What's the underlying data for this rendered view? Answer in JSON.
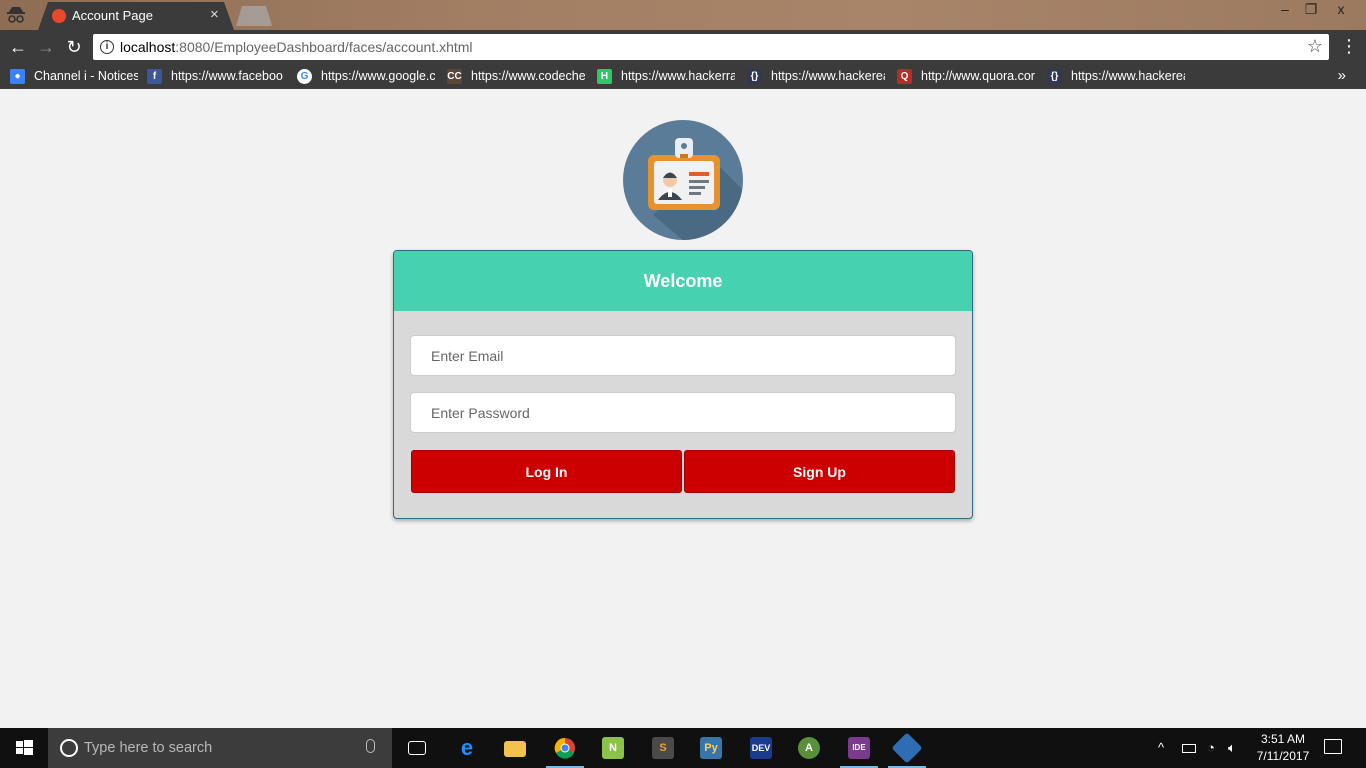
{
  "browser": {
    "tab": {
      "title": "Account Page",
      "close": "×"
    },
    "url": {
      "host": "localhost",
      "rest": ":8080/EmployeeDashboard/faces/account.xhtml"
    },
    "window": {
      "minimize": "–",
      "restore": "❐",
      "close": "x"
    }
  },
  "bookmarks": [
    {
      "label": "Channel i - Notices",
      "icon": "person-icon",
      "color": "#3b82f6"
    },
    {
      "label": "https://www.faceboo",
      "icon": "facebook-icon",
      "color": "#3b5998"
    },
    {
      "label": "https://www.google.c",
      "icon": "google-icon",
      "color": "#ffffff"
    },
    {
      "label": "https://www.codeche",
      "icon": "codechef-icon",
      "color": "#5b4638"
    },
    {
      "label": "https://www.hackerra",
      "icon": "hackerrank-icon",
      "color": "#2ec866"
    },
    {
      "label": "https://www.hackerea",
      "icon": "hackerearth-icon",
      "color": "#323754"
    },
    {
      "label": "http://www.quora.cor",
      "icon": "quora-icon",
      "color": "#b92b27"
    },
    {
      "label": "https://www.hackerea",
      "icon": "hackerearth-icon",
      "color": "#323754"
    }
  ],
  "page": {
    "header": "Welcome",
    "email_placeholder": "Enter Email",
    "password_placeholder": "Enter Password",
    "login_label": "Log In",
    "signup_label": "Sign Up",
    "colors": {
      "header": "#46d1b1",
      "button": "#cc0000",
      "avatar": "#5b7c98"
    }
  },
  "taskbar": {
    "search_placeholder": "Type here to search",
    "time": "3:51 AM",
    "date": "7/11/2017"
  }
}
